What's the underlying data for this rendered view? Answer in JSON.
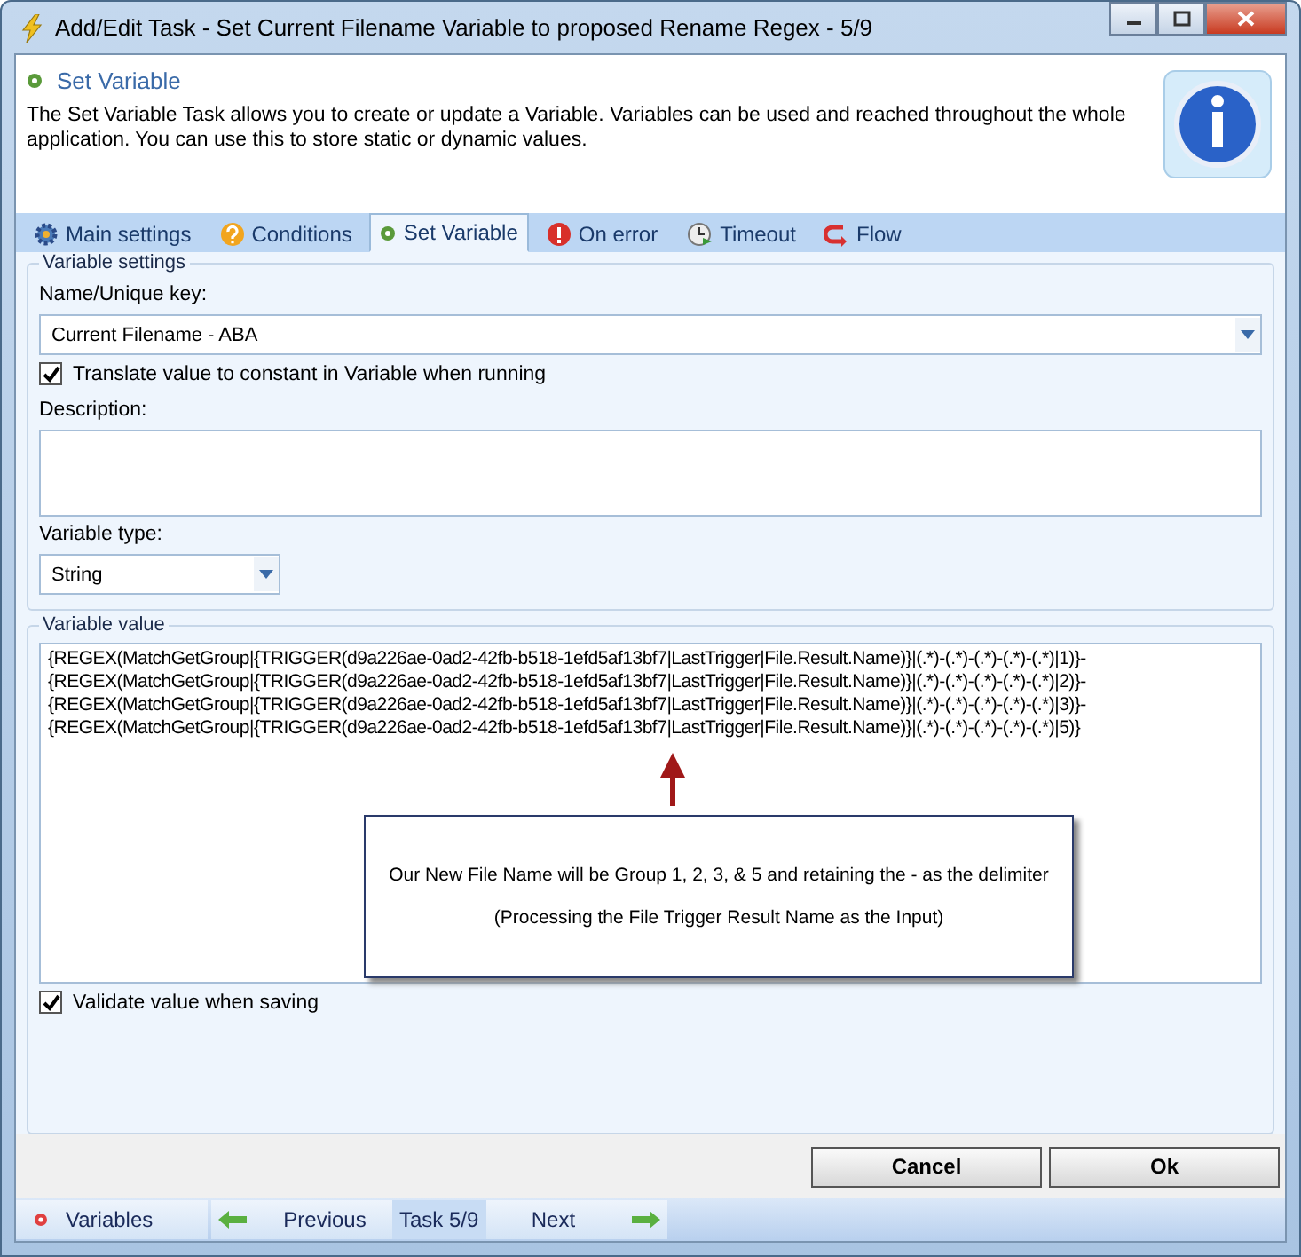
{
  "window": {
    "title": "Add/Edit Task - Set Current Filename Variable to proposed Rename Regex - 5/9"
  },
  "header": {
    "title": "Set Variable",
    "description": "The Set Variable Task allows you to create or update a Variable. Variables can be used and reached throughout the whole application. You can use this to store static or dynamic values."
  },
  "tabs": [
    {
      "label": "Main settings",
      "selected": false
    },
    {
      "label": "Conditions",
      "selected": false
    },
    {
      "label": "Set Variable",
      "selected": true
    },
    {
      "label": "On error",
      "selected": false
    },
    {
      "label": "Timeout",
      "selected": false
    },
    {
      "label": "Flow",
      "selected": false
    }
  ],
  "variable_settings": {
    "legend": "Variable settings",
    "name_label": "Name/Unique key:",
    "name_value": "Current Filename - ABA",
    "translate": {
      "label": "Translate value to constant in Variable when running",
      "checked": true
    },
    "description_label": "Description:",
    "type_label": "Variable type:",
    "type_value": "String"
  },
  "variable_value": {
    "legend": "Variable value",
    "lines": [
      "{REGEX(MatchGetGroup|{TRIGGER(d9a226ae-0ad2-42fb-b518-1efd5af13bf7|LastTrigger|File.Result.Name)}|(.*)-(.*)-(.*)-(.*)-(.*)|1)}-",
      "{REGEX(MatchGetGroup|{TRIGGER(d9a226ae-0ad2-42fb-b518-1efd5af13bf7|LastTrigger|File.Result.Name)}|(.*)-(.*)-(.*)-(.*)-(.*)|2)}-",
      "{REGEX(MatchGetGroup|{TRIGGER(d9a226ae-0ad2-42fb-b518-1efd5af13bf7|LastTrigger|File.Result.Name)}|(.*)-(.*)-(.*)-(.*)-(.*)|3)}-",
      "{REGEX(MatchGetGroup|{TRIGGER(d9a226ae-0ad2-42fb-b518-1efd5af13bf7|LastTrigger|File.Result.Name)}|(.*)-(.*)-(.*)-(.*)-(.*)|5)}"
    ],
    "callout": [
      "Our New File Name will be Group 1, 2, 3, & 5 and retaining the - as the delimiter",
      "(Processing the File Trigger Result Name as the Input)"
    ],
    "validate": {
      "label": "Validate value when saving",
      "checked": true
    }
  },
  "buttons": [
    "Cancel",
    "Ok"
  ],
  "bottom_bar": {
    "variables": "Variables",
    "previous": "Previous",
    "position": "Task 5/9",
    "next": "Next"
  }
}
